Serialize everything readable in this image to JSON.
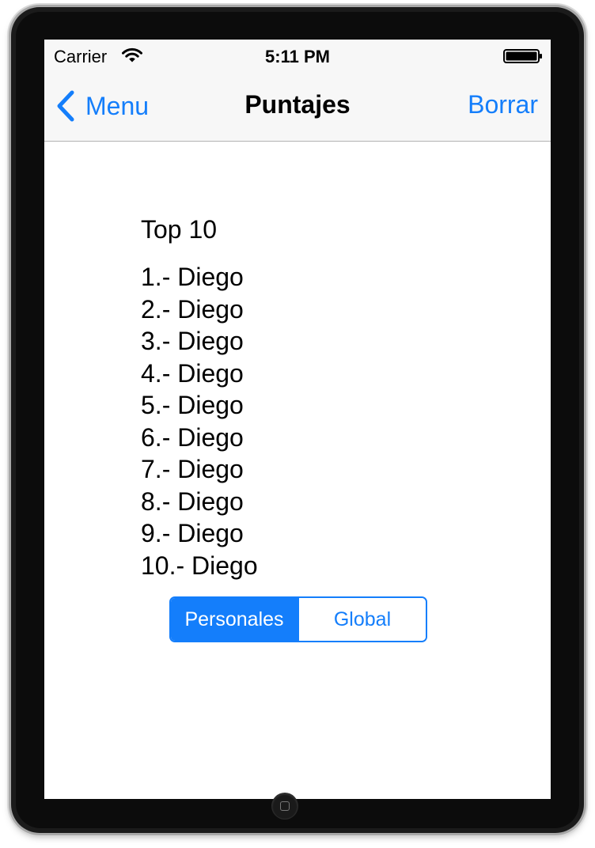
{
  "status_bar": {
    "carrier": "Carrier",
    "time": "5:11 PM",
    "icons": [
      "wifi-icon",
      "battery-icon"
    ]
  },
  "nav_bar": {
    "back_label": "Menu",
    "back_icon": "chevron-left-icon",
    "title": "Puntajes",
    "right_button": "Borrar"
  },
  "scores": {
    "title": "Top 10",
    "items": [
      "1.- Diego",
      "2.- Diego",
      "3.- Diego",
      "4.- Diego",
      "5.- Diego",
      "6.- Diego",
      "7.- Diego",
      "8.- Diego",
      "9.- Diego",
      "10.- Diego"
    ]
  },
  "segmented_control": {
    "segments": [
      "Personales",
      "Global"
    ],
    "selected": "Personales"
  },
  "colors": {
    "accent": "#147efb",
    "bar_background": "#f7f7f7",
    "device_frame": "#1b1b1b"
  }
}
